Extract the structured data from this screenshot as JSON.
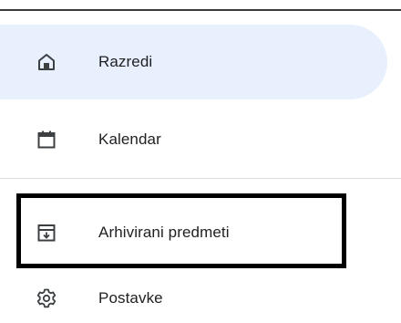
{
  "nav": {
    "items": [
      {
        "label": "Razredi",
        "icon": "home-icon",
        "active": true
      },
      {
        "label": "Kalendar",
        "icon": "calendar-icon",
        "active": false
      },
      {
        "label": "Arhivirani predmeti",
        "icon": "archive-icon",
        "active": false,
        "highlighted": true
      },
      {
        "label": "Postavke",
        "icon": "gear-icon",
        "active": false
      }
    ]
  },
  "colors": {
    "active_bg": "#e8f0fe",
    "text": "#202124",
    "icon": "#3c4043",
    "highlight_border": "#000000"
  }
}
